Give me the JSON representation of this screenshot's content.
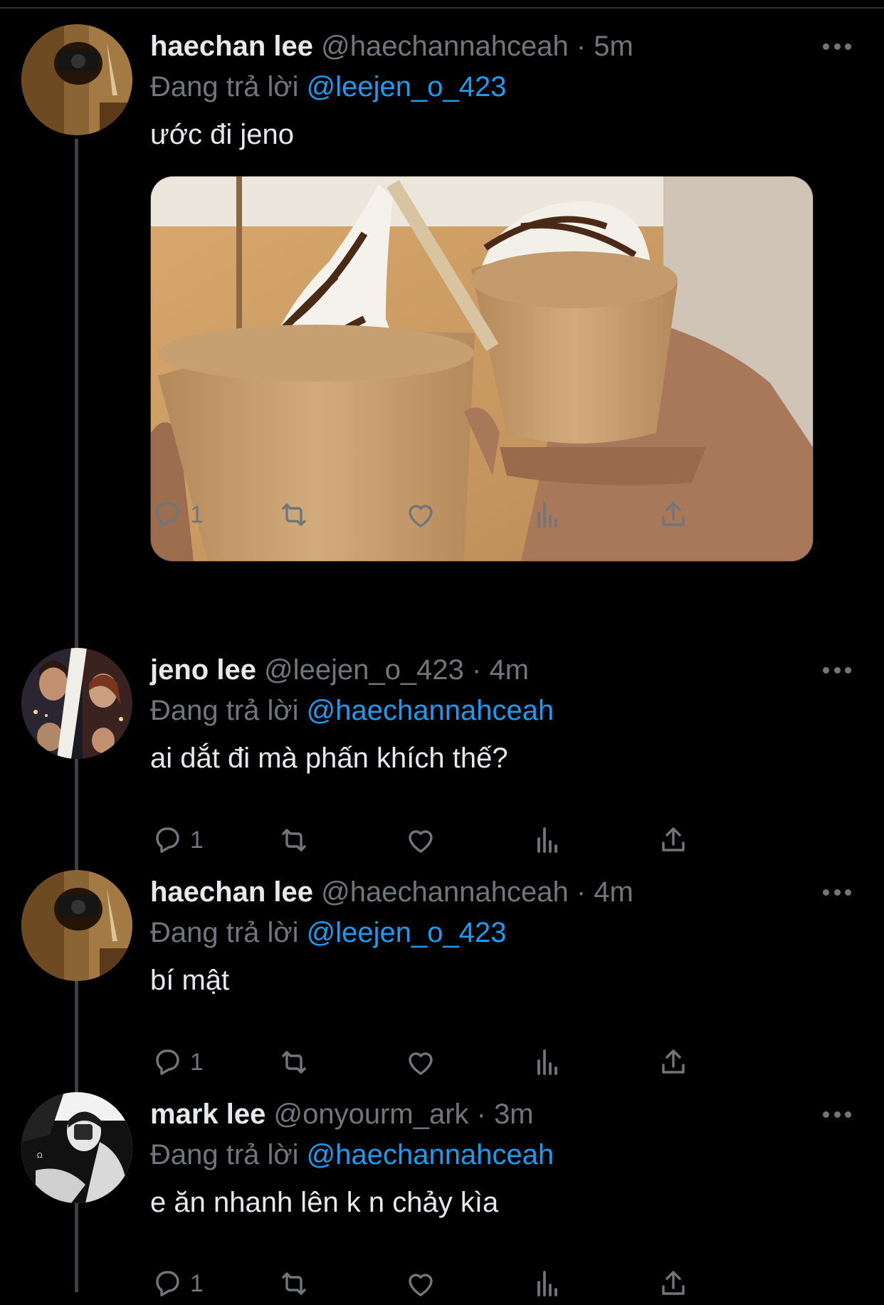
{
  "colors": {
    "background": "#000000",
    "text": "#e7e9ea",
    "muted": "#71767b",
    "accent": "#1d9bf0"
  },
  "tweets": [
    {
      "name": "haechan lee",
      "handle": "@haechannahceah",
      "sep": " · ",
      "time": "5m",
      "reply_prefix": "Đang trả lời ",
      "reply_to": "@leejen_o_423",
      "text": "ước đi jeno",
      "has_media": true,
      "reply_count": "1",
      "icons": [
        "reply-icon",
        "retweet-icon",
        "like-icon",
        "views-icon",
        "share-icon"
      ]
    },
    {
      "name": "jeno lee",
      "handle": "@leejen_o_423",
      "sep": " · ",
      "time": "4m",
      "reply_prefix": "Đang trả lời ",
      "reply_to": "@haechannahceah",
      "text": "ai dắt đi mà phấn khích thế?",
      "has_media": false,
      "reply_count": "1",
      "icons": [
        "reply-icon",
        "retweet-icon",
        "like-icon",
        "views-icon",
        "share-icon"
      ]
    },
    {
      "name": "haechan lee",
      "handle": "@haechannahceah",
      "sep": " · ",
      "time": "4m",
      "reply_prefix": "Đang trả lời ",
      "reply_to": "@leejen_o_423",
      "text": "bí mật",
      "has_media": false,
      "reply_count": "1",
      "icons": [
        "reply-icon",
        "retweet-icon",
        "like-icon",
        "views-icon",
        "share-icon"
      ]
    },
    {
      "name": "mark lee",
      "handle": "@onyourm_ark",
      "sep": " · ",
      "time": "3m",
      "reply_prefix": "Đang trả lời ",
      "reply_to": "@haechannahceah",
      "text": "e ăn nhanh lên k n chảy kìa",
      "has_media": false,
      "reply_count": "1",
      "icons": [
        "reply-icon",
        "retweet-icon",
        "like-icon",
        "views-icon",
        "share-icon"
      ]
    }
  ]
}
